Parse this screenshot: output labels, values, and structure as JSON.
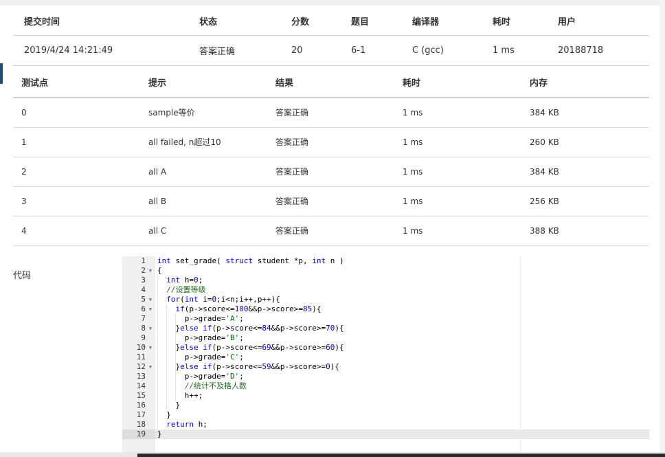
{
  "summary": {
    "headers": [
      "提交时间",
      "状态",
      "分数",
      "题目",
      "编译器",
      "耗时",
      "用户"
    ],
    "row": {
      "time": "2019/4/24 14:21:49",
      "status": "答案正确",
      "score": "20",
      "problem": "6-1",
      "compiler": "C (gcc)",
      "elapsed": "1 ms",
      "user": "20188718"
    }
  },
  "cases": {
    "headers": [
      "测试点",
      "提示",
      "结果",
      "耗时",
      "内存"
    ],
    "rows": [
      {
        "id": "0",
        "hint": "sample等价",
        "result": "答案正确",
        "time": "1 ms",
        "memory": "384 KB"
      },
      {
        "id": "1",
        "hint": "all failed, n超过10",
        "result": "答案正确",
        "time": "1 ms",
        "memory": "260 KB"
      },
      {
        "id": "2",
        "hint": "all A",
        "result": "答案正确",
        "time": "1 ms",
        "memory": "384 KB"
      },
      {
        "id": "3",
        "hint": "all B",
        "result": "答案正确",
        "time": "1 ms",
        "memory": "256 KB"
      },
      {
        "id": "4",
        "hint": "all C",
        "result": "答案正确",
        "time": "1 ms",
        "memory": "388 KB"
      }
    ]
  },
  "code": {
    "label": "代码",
    "lines": [
      {
        "n": "1",
        "fold": false,
        "text": "int set_grade( struct student *p, int n )"
      },
      {
        "n": "2",
        "fold": true,
        "text": "{"
      },
      {
        "n": "3",
        "fold": false,
        "text": "  int h=0;"
      },
      {
        "n": "4",
        "fold": false,
        "text": "  //设置等级"
      },
      {
        "n": "5",
        "fold": true,
        "text": "  for(int i=0;i<n;i++,p++){"
      },
      {
        "n": "6",
        "fold": true,
        "text": "    if(p->score<=100&&p->score>=85){"
      },
      {
        "n": "7",
        "fold": false,
        "text": "      p->grade='A';"
      },
      {
        "n": "8",
        "fold": true,
        "text": "    }else if(p->score<=84&&p->score>=70){"
      },
      {
        "n": "9",
        "fold": false,
        "text": "      p->grade='B';"
      },
      {
        "n": "10",
        "fold": true,
        "text": "    }else if(p->score<=69&&p->score>=60){"
      },
      {
        "n": "11",
        "fold": false,
        "text": "      p->grade='C';"
      },
      {
        "n": "12",
        "fold": true,
        "text": "    }else if(p->score<=59&&p->score>=0){"
      },
      {
        "n": "13",
        "fold": false,
        "text": "      p->grade='D';"
      },
      {
        "n": "14",
        "fold": false,
        "text": "      //统计不及格人数"
      },
      {
        "n": "15",
        "fold": false,
        "text": "      h++;"
      },
      {
        "n": "16",
        "fold": false,
        "text": "    }"
      },
      {
        "n": "17",
        "fold": false,
        "text": "  }"
      },
      {
        "n": "18",
        "fold": false,
        "text": "  return h;"
      },
      {
        "n": "19",
        "fold": false,
        "text": "}"
      }
    ]
  },
  "colors": {
    "status_ok": "#e0403a",
    "link": "#1f5e9a",
    "keyword": "#0000ff",
    "number": "#0000cd",
    "comment": "#236e24",
    "string": "#036a07"
  }
}
